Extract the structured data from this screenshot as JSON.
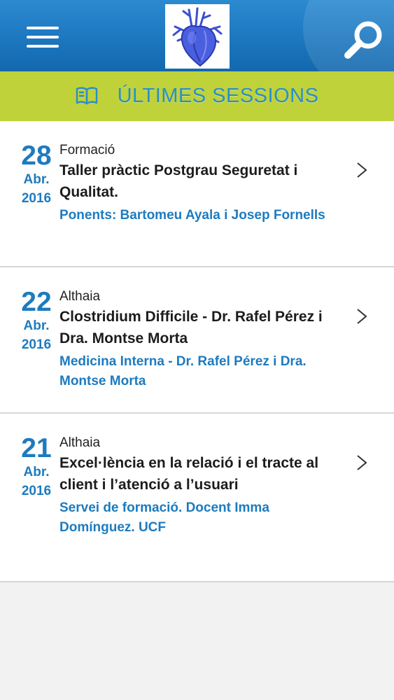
{
  "header": {
    "menu_icon": "hamburger-menu-icon",
    "logo_icon": "heart-logo-icon",
    "search_icon": "magnifier-search-icon",
    "brand_color": "#1d77bf"
  },
  "section": {
    "title": "ÚLTIMES SESSIONS",
    "icon": "open-book-icon",
    "color": "#bfd23a"
  },
  "sessions": [
    {
      "day": "28",
      "month": "Abr.",
      "year": "2016",
      "category": "Formació",
      "title": "Taller pràctic Postgrau Seguretat i Qualitat.",
      "speakers": "Ponents: Bartomeu Ayala i Josep Fornells"
    },
    {
      "day": "22",
      "month": "Abr.",
      "year": "2016",
      "category": "Althaia",
      "title": "Clostridium Difficile - Dr. Rafel Pérez i Dra. Montse Morta",
      "speakers": "Medicina Interna - Dr. Rafel Pérez i Dra. Montse Morta"
    },
    {
      "day": "21",
      "month": "Abr.",
      "year": "2016",
      "category": "Althaia",
      "title": "Excel·lència en la relació i el tracte al client i l’atenció a l’usuari",
      "speakers": "Servei de formació. Docent Imma Domínguez. UCF"
    }
  ]
}
